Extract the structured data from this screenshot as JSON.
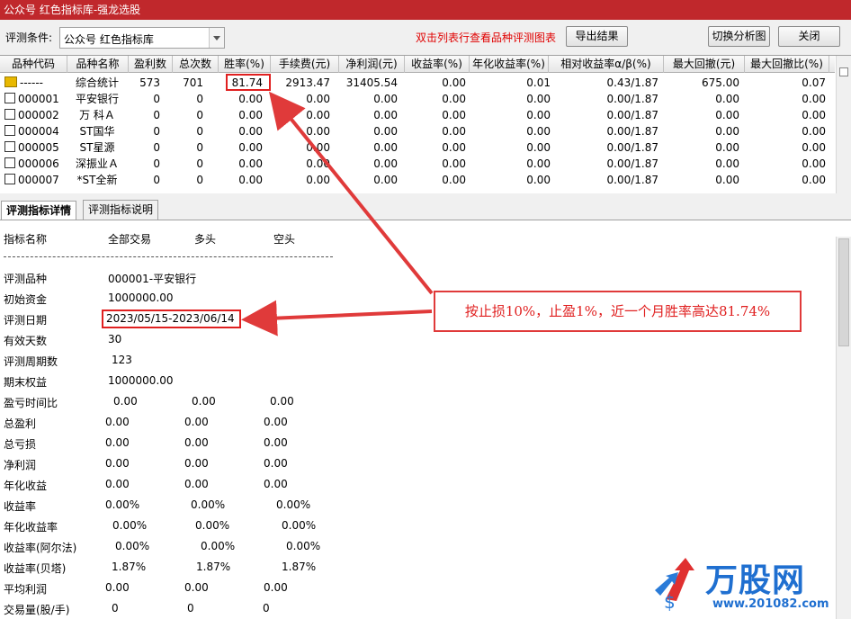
{
  "window": {
    "title": "公众号 红色指标库-强龙选股"
  },
  "toolbar": {
    "condition_label": "评测条件:",
    "condition_value": "公众号 红色指标库",
    "hint": "双击列表行查看品种评测图表",
    "export_label": "导出结果",
    "switch_label": "切换分析图",
    "close_label": "关闭"
  },
  "table": {
    "columns": [
      "品种代码",
      "品种名称",
      "盈利数",
      "总次数",
      "胜率(%)",
      "手续费(元)",
      "净利润(元)",
      "收益率(%)",
      "年化收益率(%)",
      "相对收益率α/β(%)",
      "最大回撤(元)",
      "最大回撤比(%)"
    ],
    "rows": [
      [
        "------",
        "综合统计",
        "573",
        "701",
        "81.74",
        "2913.47",
        "31405.54",
        "0.00",
        "0.01",
        "0.43/1.87",
        "675.00",
        "0.07"
      ],
      [
        "000001",
        "平安银行",
        "0",
        "0",
        "0.00",
        "0.00",
        "0.00",
        "0.00",
        "0.00",
        "0.00/1.87",
        "0.00",
        "0.00"
      ],
      [
        "000002",
        "万 科Ａ",
        "0",
        "0",
        "0.00",
        "0.00",
        "0.00",
        "0.00",
        "0.00",
        "0.00/1.87",
        "0.00",
        "0.00"
      ],
      [
        "000004",
        "ST国华",
        "0",
        "0",
        "0.00",
        "0.00",
        "0.00",
        "0.00",
        "0.00",
        "0.00/1.87",
        "0.00",
        "0.00"
      ],
      [
        "000005",
        "ST星源",
        "0",
        "0",
        "0.00",
        "0.00",
        "0.00",
        "0.00",
        "0.00",
        "0.00/1.87",
        "0.00",
        "0.00"
      ],
      [
        "000006",
        "深振业Ａ",
        "0",
        "0",
        "0.00",
        "0.00",
        "0.00",
        "0.00",
        "0.00",
        "0.00/1.87",
        "0.00",
        "0.00"
      ],
      [
        "000007",
        "*ST全新",
        "0",
        "0",
        "0.00",
        "0.00",
        "0.00",
        "0.00",
        "0.00",
        "0.00/1.87",
        "0.00",
        "0.00"
      ]
    ]
  },
  "tabs": [
    {
      "label": "评测指标详情",
      "active": true
    },
    {
      "label": "评测指标说明",
      "active": false
    }
  ],
  "detail": {
    "headers": [
      "指标名称",
      "全部交易",
      "多头",
      "空头"
    ],
    "rows": [
      {
        "name": "评测品种",
        "values": [
          "000001-平安银行"
        ]
      },
      {
        "name": "初始资金",
        "values": [
          "1000000.00"
        ]
      },
      {
        "name": "评测日期",
        "values": [
          "2023/05/15-2023/06/14"
        ]
      },
      {
        "name": "有效天数",
        "values": [
          "30"
        ]
      },
      {
        "name": "评测周期数",
        "values": [
          "123"
        ]
      },
      {
        "name": "期末权益",
        "values": [
          "1000000.00"
        ]
      },
      {
        "name": "盈亏时间比",
        "values": [
          "0.00",
          "0.00",
          "0.00"
        ]
      },
      {
        "name": "总盈利",
        "values": [
          "0.00",
          "0.00",
          "0.00"
        ]
      },
      {
        "name": "总亏损",
        "values": [
          "0.00",
          "0.00",
          "0.00"
        ]
      },
      {
        "name": "净利润",
        "values": [
          "0.00",
          "0.00",
          "0.00"
        ]
      },
      {
        "name": "年化收益",
        "values": [
          "0.00",
          "0.00",
          "0.00"
        ]
      },
      {
        "name": "收益率",
        "values": [
          "0.00%",
          "0.00%",
          "0.00%"
        ]
      },
      {
        "name": "年化收益率",
        "values": [
          "0.00%",
          "0.00%",
          "0.00%"
        ]
      },
      {
        "name": "收益率(阿尔法)",
        "values": [
          "0.00%",
          "0.00%",
          "0.00%"
        ]
      },
      {
        "name": "收益率(贝塔)",
        "values": [
          "1.87%",
          "1.87%",
          "1.87%"
        ]
      },
      {
        "name": "平均利润",
        "values": [
          "0.00",
          "0.00",
          "0.00"
        ]
      },
      {
        "name": "交易量(股/手)",
        "values": [
          "0",
          "0",
          "0"
        ]
      }
    ]
  },
  "annotation": {
    "text": "按止损10%，止盈1%，近一个月胜率高达81.74%"
  },
  "watermark": {
    "brand": "万股网",
    "url": "www.201082.com"
  },
  "colors": {
    "title_bar": "#c0282c",
    "hint": "#e00000",
    "annotation": "#e02020"
  }
}
